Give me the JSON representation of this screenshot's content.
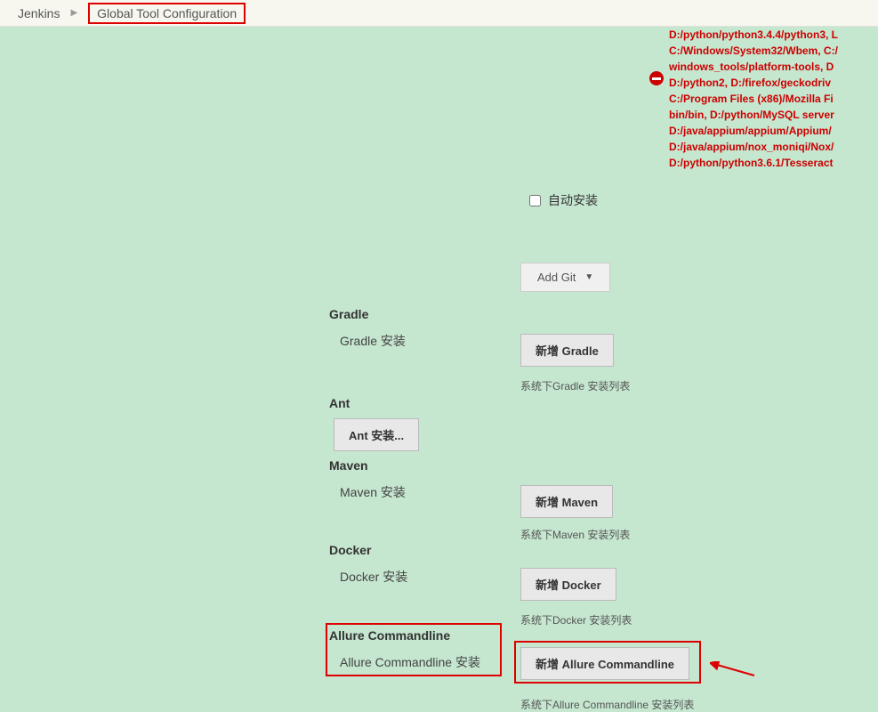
{
  "breadcrumb": {
    "home": "Jenkins",
    "current": "Global Tool Configuration"
  },
  "error_text": "D:/python/python3.4.4/python3, L\nC:/Windows/System32/Wbem, C:/\nwindows_tools/platform-tools, D\nD:/python2, D:/firefox/geckodriv\nC:/Program Files (x86)/Mozilla Fi\nbin/bin, D:/python/MySQL server\nD:/java/appium/appium/Appium/\nD:/java/appium/nox_moniqi/Nox/\nD:/python/python3.6.1/Tesseract",
  "auto_install_label": "自动安装",
  "add_git_label": "Add Git",
  "sections": {
    "gradle": {
      "title": "Gradle",
      "sub": "Gradle 安装",
      "btn": "新增 Gradle",
      "desc": "系统下Gradle 安装列表"
    },
    "ant": {
      "title": "Ant",
      "btn": "Ant 安装..."
    },
    "maven": {
      "title": "Maven",
      "sub": "Maven 安装",
      "btn": "新增 Maven",
      "desc": "系统下Maven 安装列表"
    },
    "docker": {
      "title": "Docker",
      "sub": "Docker 安装",
      "btn": "新增 Docker",
      "desc": "系统下Docker 安装列表"
    },
    "allure": {
      "title": "Allure Commandline",
      "sub": "Allure Commandline 安装",
      "btn": "新增 Allure Commandline",
      "desc": "系统下Allure Commandline 安装列表"
    }
  }
}
